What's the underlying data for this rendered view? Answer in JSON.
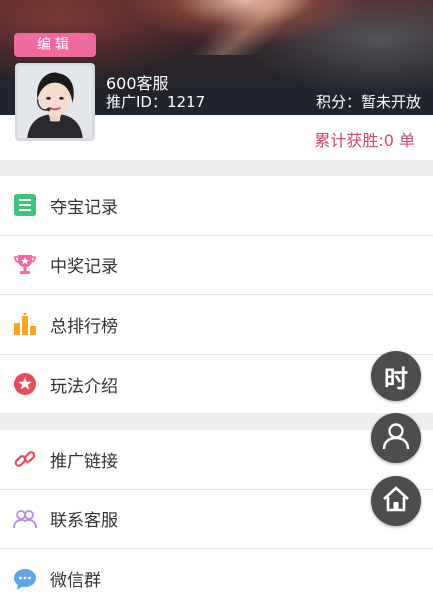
{
  "profile": {
    "edit_label": "编辑",
    "name": "600客服",
    "promo_id": "推广ID：1217",
    "points": "积分：暂未开放",
    "wins": "累计获胜:0 单"
  },
  "menu_primary": [
    {
      "label": "夺宝记录",
      "icon": "list-icon",
      "color": "#3cc47c"
    },
    {
      "label": "中奖记录",
      "icon": "trophy-icon",
      "color": "#f06aa0"
    },
    {
      "label": "总排行榜",
      "icon": "ranking-icon",
      "color": "#f5a623"
    },
    {
      "label": "玩法介绍",
      "icon": "star-badge-icon",
      "color": "#e84b5a"
    }
  ],
  "menu_secondary": [
    {
      "label": "推广链接",
      "icon": "link-icon",
      "color": "#e84b5a"
    },
    {
      "label": "联系客服",
      "icon": "contacts-icon",
      "color": "#b48ae0"
    },
    {
      "label": "微信群",
      "icon": "chat-icon",
      "color": "#5aa6e8"
    }
  ],
  "floating": {
    "time_label": "时",
    "icons": [
      "time-button",
      "user-icon",
      "home-icon"
    ]
  },
  "colors": {
    "accent_pink": "#f06aa0",
    "wins_text": "#d04a6a",
    "fab_bg": "#4d4d4d"
  }
}
